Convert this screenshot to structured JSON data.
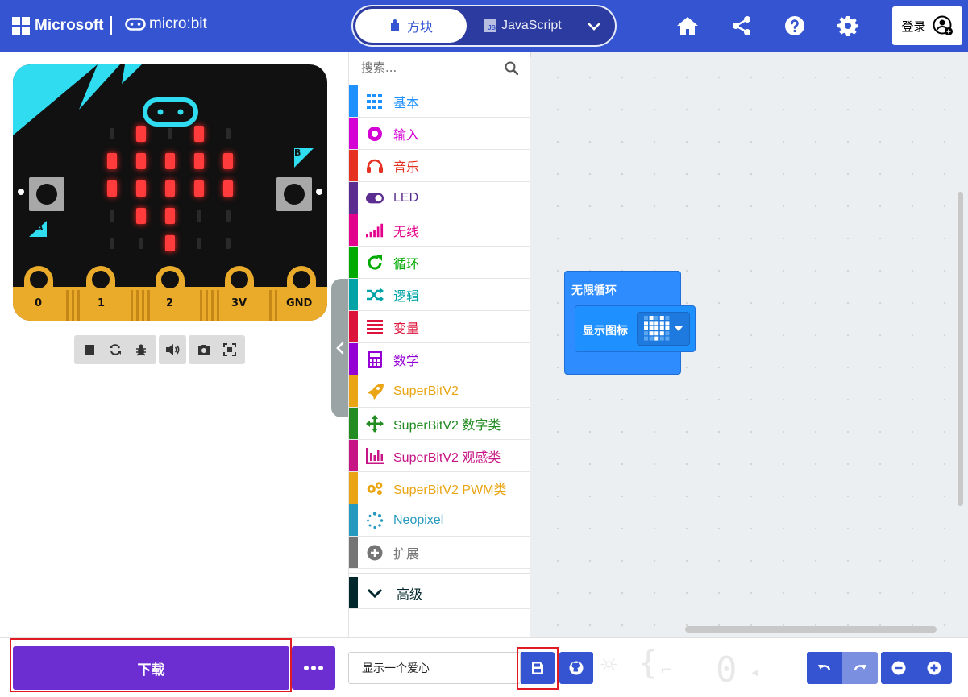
{
  "header": {
    "brand": "Microsoft",
    "product": "micro:bit",
    "tab_blocks": "方块",
    "tab_js": "JavaScript",
    "js_badge": "JS",
    "signin": "登录",
    "icons": [
      "home-icon",
      "share-icon",
      "help-icon",
      "settings-icon"
    ]
  },
  "simulator": {
    "button_a": "A",
    "button_b": "B",
    "pins": [
      "0",
      "1",
      "2",
      "3V",
      "GND"
    ],
    "led_matrix": [
      [
        0,
        1,
        0,
        1,
        0
      ],
      [
        1,
        1,
        1,
        1,
        1
      ],
      [
        1,
        1,
        1,
        1,
        1
      ],
      [
        0,
        1,
        1,
        0,
        0
      ],
      [
        0,
        0,
        1,
        0,
        0
      ]
    ],
    "controls": [
      "stop-icon",
      "restart-icon",
      "debug-icon",
      "mute-icon",
      "screenshot-icon",
      "fullscreen-icon"
    ]
  },
  "toolbox": {
    "search_placeholder": "搜索...",
    "categories": [
      {
        "label": "基本",
        "color": "#1e90ff",
        "icon": "grid-icon"
      },
      {
        "label": "输入",
        "color": "#d400d4",
        "icon": "input-icon"
      },
      {
        "label": "音乐",
        "color": "#e63022",
        "icon": "headphones-icon"
      },
      {
        "label": "LED",
        "color": "#5c2d91",
        "icon": "toggle-icon"
      },
      {
        "label": "无线",
        "color": "#e3008c",
        "icon": "signal-icon"
      },
      {
        "label": "循环",
        "color": "#00aa00",
        "icon": "loop-icon"
      },
      {
        "label": "逻辑",
        "color": "#00a4a6",
        "icon": "shuffle-icon"
      },
      {
        "label": "变量",
        "color": "#dc143c",
        "icon": "list-icon"
      },
      {
        "label": "数学",
        "color": "#9400d3",
        "icon": "calculator-icon"
      },
      {
        "label": "SuperBitV2",
        "color": "#eaa514",
        "icon": "rocket-icon"
      },
      {
        "label": "SuperBitV2 数字类",
        "color": "#228b22",
        "icon": "move-icon"
      },
      {
        "label": "SuperBitV2 观感类",
        "color": "#c71585",
        "icon": "chart-icon"
      },
      {
        "label": "SuperBitV2 PWM类",
        "color": "#eaa514",
        "icon": "gears-icon"
      },
      {
        "label": "Neopixel",
        "color": "#2699bf",
        "icon": "spinner-icon"
      },
      {
        "label": "扩展",
        "color": "#757575",
        "icon": "plus-circle-icon"
      },
      {
        "label": "高级",
        "color": "#00272b",
        "icon": "chevron-down-icon"
      }
    ]
  },
  "workspace": {
    "forever_label": "无限循环",
    "show_icon_label": "显示图标",
    "heart_icon": [
      [
        0,
        1,
        0,
        1,
        0
      ],
      [
        1,
        1,
        1,
        1,
        1
      ],
      [
        1,
        1,
        1,
        1,
        1
      ],
      [
        0,
        1,
        1,
        1,
        0
      ],
      [
        0,
        0,
        1,
        0,
        0
      ]
    ]
  },
  "bottombar": {
    "download": "下载",
    "project_name": "显示一个爱心",
    "icons": [
      "more-icon",
      "save-icon",
      "github-icon",
      "undo-icon",
      "redo-icon",
      "zoom-out-icon",
      "zoom-in-icon"
    ]
  }
}
